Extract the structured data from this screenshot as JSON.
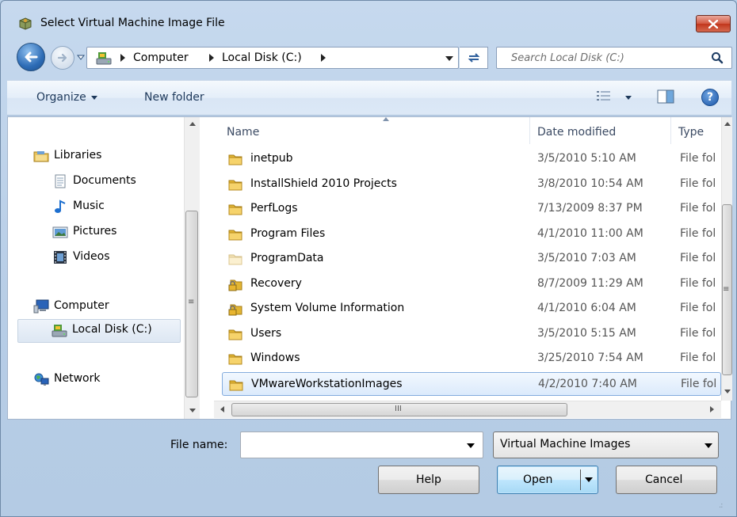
{
  "window": {
    "title": "Select Virtual Machine Image File",
    "icon": "vmware-package-icon"
  },
  "address": {
    "crumbs": [
      "Computer",
      "Local Disk (C:)"
    ],
    "search_placeholder": "Search Local Disk (C:)"
  },
  "toolbar": {
    "organize_label": "Organize",
    "new_folder_label": "New folder",
    "help_glyph": "?"
  },
  "nav": {
    "items": [
      {
        "label": "Libraries",
        "icon": "libraries-icon"
      },
      {
        "label": "Documents",
        "icon": "documents-icon"
      },
      {
        "label": "Music",
        "icon": "music-icon"
      },
      {
        "label": "Pictures",
        "icon": "pictures-icon"
      },
      {
        "label": "Videos",
        "icon": "videos-icon"
      },
      {
        "label": "Computer",
        "icon": "computer-icon"
      },
      {
        "label": "Local Disk (C:)",
        "icon": "local-disk-icon"
      },
      {
        "label": "Network",
        "icon": "network-icon"
      }
    ]
  },
  "files": {
    "columns": [
      "Name",
      "Date modified",
      "Type"
    ],
    "rows": [
      {
        "name": "inetpub",
        "date": "3/5/2010 5:10 AM",
        "type": "File fol",
        "icon": "folder-icon"
      },
      {
        "name": "InstallShield 2010 Projects",
        "date": "3/8/2010 10:54 AM",
        "type": "File fol",
        "icon": "folder-icon"
      },
      {
        "name": "PerfLogs",
        "date": "7/13/2009 8:37 PM",
        "type": "File fol",
        "icon": "folder-icon"
      },
      {
        "name": "Program Files",
        "date": "4/1/2010 11:00 AM",
        "type": "File fol",
        "icon": "folder-icon"
      },
      {
        "name": "ProgramData",
        "date": "3/5/2010 7:03 AM",
        "type": "File fol",
        "icon": "hidden-folder-icon"
      },
      {
        "name": "Recovery",
        "date": "8/7/2009 11:29 AM",
        "type": "File fol",
        "icon": "locked-folder-icon"
      },
      {
        "name": "System Volume Information",
        "date": "4/1/2010 6:04 AM",
        "type": "File fol",
        "icon": "locked-folder-icon"
      },
      {
        "name": "Users",
        "date": "3/5/2010 5:15 AM",
        "type": "File fol",
        "icon": "folder-icon"
      },
      {
        "name": "Windows",
        "date": "3/25/2010 7:54 AM",
        "type": "File fol",
        "icon": "folder-icon"
      },
      {
        "name": "VMwareWorkstationImages",
        "date": "4/2/2010 7:40 AM",
        "type": "File fol",
        "icon": "folder-icon",
        "selected": true
      }
    ]
  },
  "bottom": {
    "file_name_label": "File name:",
    "file_name_value": "",
    "file_type_value": "Virtual Machine Images",
    "help_label": "Help",
    "open_label": "Open",
    "cancel_label": "Cancel"
  },
  "colors": {
    "selection": "#dbeafc",
    "selection_border": "#84acdd",
    "toolbar_text": "#1e395b"
  }
}
